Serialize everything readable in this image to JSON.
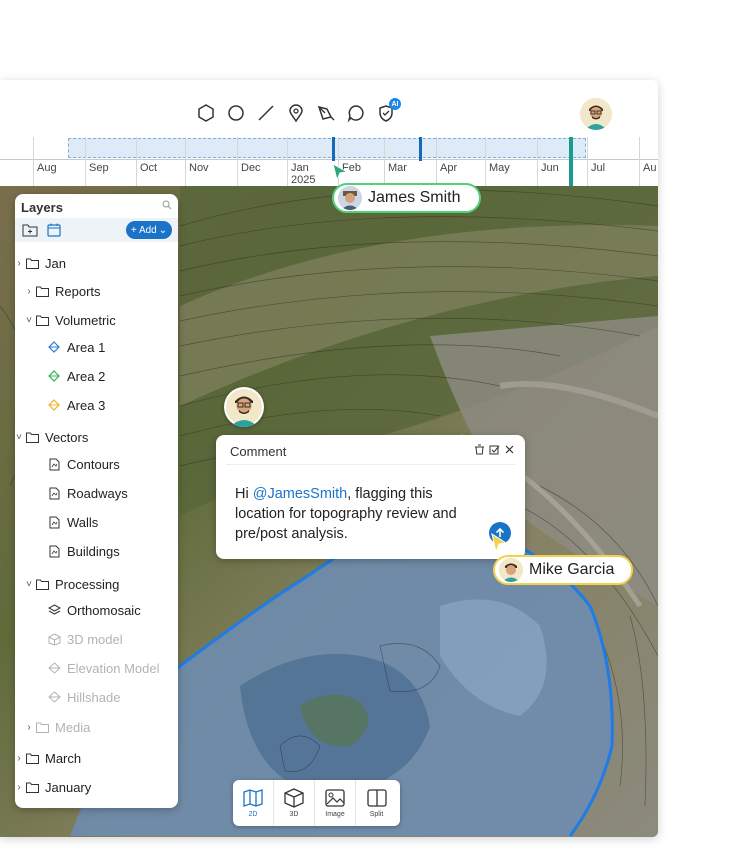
{
  "toolbar": {
    "tools": [
      "hexagon-tool-icon",
      "circle-tool-icon",
      "line-tool-icon",
      "pin-tool-icon",
      "pen-tool-icon",
      "comment-tool-icon",
      "ai-shield-tool-icon"
    ],
    "ai_badge": "AI"
  },
  "timeline": {
    "months": [
      "Aug",
      "Sep",
      "Oct",
      "Nov",
      "Dec",
      "Jan",
      "Feb",
      "Mar",
      "Apr",
      "May",
      "Jun",
      "Jul",
      "Au"
    ],
    "year_label": "2025"
  },
  "layers": {
    "title": "Layers",
    "add_label": "+ Add",
    "items": [
      {
        "label": "Jan",
        "type": "folder"
      },
      {
        "label": "Reports",
        "type": "folder"
      },
      {
        "label": "Volumetric",
        "type": "folder"
      },
      {
        "label": "Area 1",
        "type": "area",
        "color": "#2f7bd8"
      },
      {
        "label": "Area 2",
        "type": "area",
        "color": "#33b35a"
      },
      {
        "label": "Area 3",
        "type": "area",
        "color": "#f0b22b"
      },
      {
        "label": "Vectors",
        "type": "folder"
      },
      {
        "label": "Contours",
        "type": "file"
      },
      {
        "label": "Roadways",
        "type": "file"
      },
      {
        "label": "Walls",
        "type": "file"
      },
      {
        "label": "Buildings",
        "type": "file"
      },
      {
        "label": "Processing",
        "type": "folder"
      },
      {
        "label": "Orthomosaic",
        "type": "layers"
      },
      {
        "label": "3D model",
        "type": "cube"
      },
      {
        "label": "Elevation Model",
        "type": "layers"
      },
      {
        "label": "Hillshade",
        "type": "layers"
      },
      {
        "label": "Media",
        "type": "folder"
      },
      {
        "label": "March",
        "type": "folder"
      },
      {
        "label": "January",
        "type": "folder"
      }
    ]
  },
  "users": {
    "james": "James Smith",
    "mike": "Mike Garcia"
  },
  "comment": {
    "title": "Comment",
    "body_prefix": "Hi ",
    "mention": "@JamesSmith",
    "body_suffix": ", flagging this location for topography review and pre/post analysis."
  },
  "viewbar": {
    "buttons": [
      "2D",
      "3D",
      "Image",
      "Split"
    ],
    "active": "2D"
  },
  "colors": {
    "accent": "#1a73c9",
    "james_outline": "#4fd17a",
    "mike_outline": "#f2d24a",
    "polygon": "#1e7be8"
  }
}
